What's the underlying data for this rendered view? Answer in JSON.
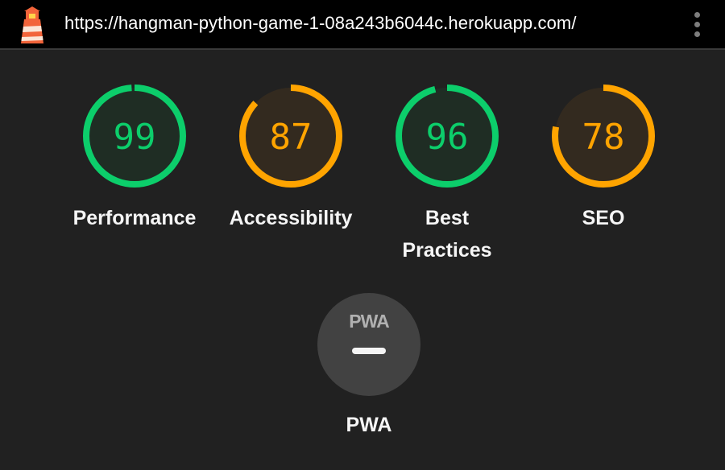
{
  "header": {
    "url": "https://hangman-python-game-1-08a243b6044c.herokuapp.com/",
    "logo_icon": "lighthouse-icon",
    "menu_icon": "more-vertical-icon"
  },
  "colors": {
    "pass": "#0cce6b",
    "pass_text": "#0cce6b",
    "average": "#ffa400",
    "average_text": "#ffa400",
    "pass_bg": "#1f2d24",
    "average_bg": "#332a1f",
    "background": "#212121",
    "topbar": "#000000"
  },
  "gauges": [
    {
      "label": "Performance",
      "score": "99",
      "status": "pass"
    },
    {
      "label": "Accessibility",
      "score": "87",
      "status": "average"
    },
    {
      "label": "Best Practices",
      "score": "96",
      "status": "pass"
    },
    {
      "label": "SEO",
      "score": "78",
      "status": "average"
    }
  ],
  "pwa": {
    "badge_text": "PWA",
    "label": "PWA",
    "icon": "pwa-dash-icon"
  }
}
